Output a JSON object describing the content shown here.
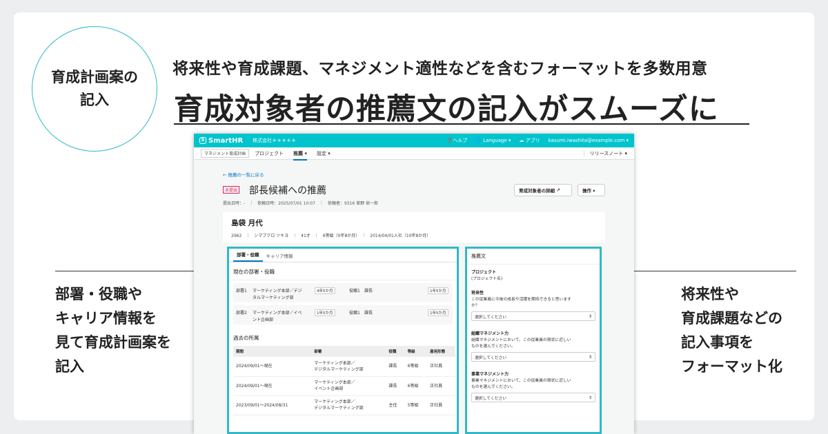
{
  "banner": {
    "circle_line1": "育成計画案の",
    "circle_line2": "記入",
    "subtitle": "将来性や育成課題、マネジメント適性などを含むフォーマットを多数用意",
    "title": "育成対象者の推薦文の記入がスムーズに",
    "left_callout": [
      "部署・役職や",
      "キャリア情報を",
      "見て育成計画案を",
      "記入"
    ],
    "right_callout": [
      "将来性や",
      "育成課題などの",
      "記入事項を",
      "フォーマット化"
    ]
  },
  "app": {
    "logo": "SmartHR",
    "company": "株式会社＊＊＊＊＊",
    "help": "ヘルプ",
    "language": "Language",
    "apps": "アプリ",
    "email": "kasumi.iwashita@example.com",
    "nav": {
      "box": "マネジメント育成計画",
      "project": "プロジェクト",
      "recommend": "推薦",
      "settings": "設定",
      "release": "リリースノート"
    },
    "back": "推薦の一覧に戻る",
    "badge": "未提出",
    "page_title": "部長候補への推薦",
    "meta": "提出日時：-　｜　依頼日時：2025/07/01 10:07　｜　依頼者：9316 草野 栄一郎",
    "btn_detail": "育成対象者の詳細",
    "btn_ops": "操作",
    "person": {
      "name": "島袋 月代",
      "info": "2962　｜　シマブクロ ツキヨ　｜　41才　｜　6等級（0年8か月）　｜　2014/04/01入社（10年8か月）"
    },
    "left": {
      "tab1": "部署・役職",
      "tab2": "キャリア情報",
      "current_title": "現在の部署・役職",
      "depts": [
        {
          "label": "部署1",
          "name1": "マーケティング本部／デジ",
          "name2": "タルマーケティング部",
          "tenure": "4年5か月",
          "role_label": "役職1",
          "role": "課長",
          "role_tenure": "1年5か月"
        },
        {
          "label": "部署2",
          "name1": "マーケティング本部／イベ",
          "name2": "ント企画部",
          "tenure": "1年5か月",
          "role_label": "役職1",
          "role": "課長",
          "role_tenure": "1年5か月"
        }
      ],
      "past_title": "過去の所属",
      "headers": [
        "期間",
        "部署",
        "役職",
        "等級",
        "雇用形態"
      ],
      "rows": [
        {
          "period": "2024/09/01〜現在",
          "dept1": "マーケティング本部／",
          "dept2": "デジタルマーケティング部",
          "role": "課長",
          "grade": "6等級",
          "type": "正社員"
        },
        {
          "period": "2024/09/01〜現在",
          "dept1": "マーケティング本部／",
          "dept2": "イベント企画部",
          "role": "課長",
          "grade": "6等級",
          "type": "正社員"
        },
        {
          "period": "2023/09/01〜2024/08/31",
          "dept1": "マーケティング本部／",
          "dept2": "デジタルマーケティング部",
          "role": "主任",
          "grade": "5等級",
          "type": "正社員"
        }
      ]
    },
    "right": {
      "title": "推薦文",
      "project_label": "プロジェクト",
      "project_value": "(プロジェクト名)",
      "future_label": "将来性",
      "future_text1": "この従業員に今後の成長や活躍を期待できると思います",
      "future_text2": "か？",
      "select_placeholder": "選択してください",
      "org_label": "組織マネジメント力",
      "org_text1": "組織マネジメントにおいて、この従業員の現状に近しい",
      "org_text2": "ものを選んでください。",
      "biz_label": "事業マネジメント力",
      "biz_text1": "事業マネジメントにおいて、この従業員の現状に近しい",
      "biz_text2": "ものを選んでください。"
    }
  }
}
